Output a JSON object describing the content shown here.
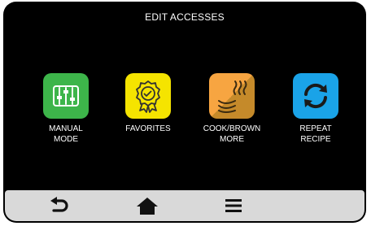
{
  "header": {
    "title": "EDIT ACCESSES"
  },
  "tiles": [
    {
      "name": "manual-mode",
      "icon": "sliders-icon",
      "color": "#3db54a",
      "label_lines": [
        "MANUAL",
        "MODE"
      ]
    },
    {
      "name": "favorites",
      "icon": "award-ribbon-icon",
      "color": "#f5e400",
      "label_lines": [
        "FAVORITES"
      ]
    },
    {
      "name": "cook-brown-more",
      "icon": "heat-pan-icon",
      "color_light": "#f7a541",
      "color_dark": "#c58a2a",
      "label_lines": [
        "COOK/BROWN",
        "MORE"
      ]
    },
    {
      "name": "repeat-recipe",
      "icon": "repeat-arrows-icon",
      "color": "#1aa3e8",
      "label_lines": [
        "REPEAT",
        "RECIPE"
      ]
    }
  ],
  "navbar": {
    "items": [
      {
        "name": "back",
        "icon": "back-arrow-icon"
      },
      {
        "name": "home",
        "icon": "home-icon"
      },
      {
        "name": "menu",
        "icon": "hamburger-menu-icon"
      }
    ]
  }
}
